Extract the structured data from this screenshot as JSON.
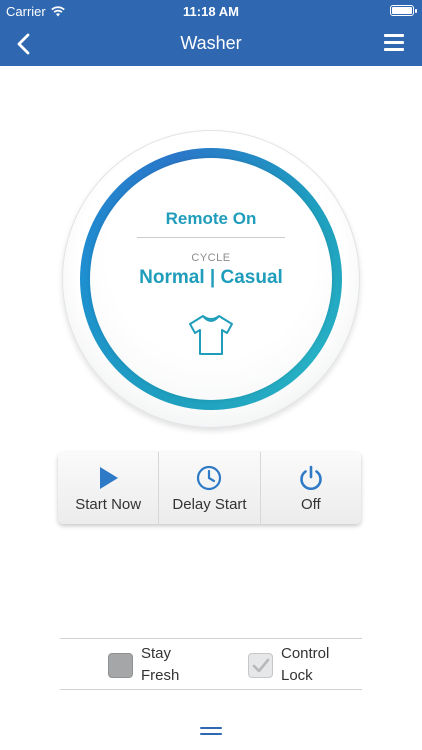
{
  "status_bar": {
    "carrier": "Carrier",
    "time": "11:18 AM"
  },
  "nav": {
    "title": "Washer",
    "back_icon": "chevron-left-icon",
    "menu_icon": "hamburger-icon"
  },
  "dial": {
    "status": "Remote On",
    "cycle_label": "CYCLE",
    "cycle_value": "Normal | Casual",
    "cycle_icon": "shirt-icon",
    "accent_color": "#1f9dbb"
  },
  "controls": [
    {
      "label": "Start Now",
      "icon": "play-icon"
    },
    {
      "label": "Delay Start",
      "icon": "clock-icon"
    },
    {
      "label": "Off",
      "icon": "power-icon"
    }
  ],
  "options": {
    "stay_fresh": {
      "line1": "Stay",
      "line2": "Fresh",
      "checked": false
    },
    "control_lock": {
      "line1": "Control",
      "line2": "Lock",
      "checked": true
    }
  },
  "colors": {
    "nav_bg": "#2f67b0",
    "accent": "#1f9dbb",
    "icon_blue": "#2f7ac6"
  }
}
